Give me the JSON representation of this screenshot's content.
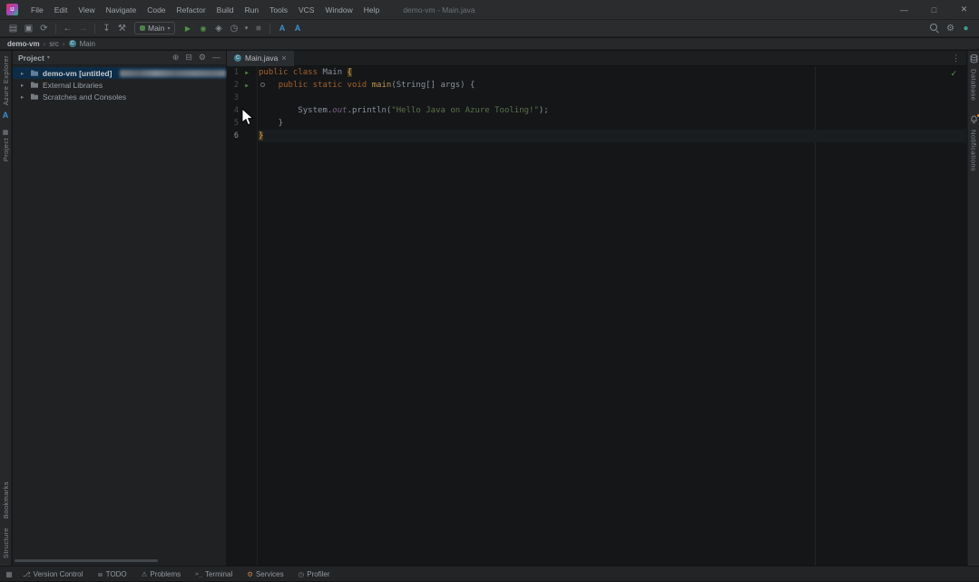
{
  "titlebar": {
    "logo_text": "IJ",
    "menus": [
      "File",
      "Edit",
      "View",
      "Navigate",
      "Code",
      "Refactor",
      "Build",
      "Run",
      "Tools",
      "VCS",
      "Window",
      "Help"
    ],
    "title": "demo-vm - Main.java",
    "controls": {
      "minimize": "—",
      "maximize": "□",
      "close": "✕"
    }
  },
  "toolbar": {
    "file_icons": [
      {
        "name": "open-icon",
        "glyph": "▤"
      },
      {
        "name": "save-all-icon",
        "glyph": "▣"
      },
      {
        "name": "sync-icon",
        "glyph": "⟳"
      }
    ],
    "nav_icons": [
      {
        "name": "back-icon",
        "glyph": "←"
      },
      {
        "name": "forward-icon",
        "glyph": "→"
      }
    ],
    "build_icons": [
      {
        "name": "update-project-icon",
        "glyph": "↧"
      },
      {
        "name": "build-hammer-icon",
        "glyph": "⚒"
      }
    ],
    "run_config": {
      "label": "Main",
      "chevron": "▾"
    },
    "run_icons": [
      {
        "name": "run-icon",
        "glyph": "▶"
      },
      {
        "name": "debug-icon",
        "glyph": "◉"
      },
      {
        "name": "coverage-icon",
        "glyph": "◈"
      },
      {
        "name": "profiler-icon",
        "glyph": "◷"
      },
      {
        "name": "run-more-chevron-icon",
        "glyph": "▾"
      },
      {
        "name": "stop-icon",
        "glyph": "■"
      }
    ],
    "azure_icons": [
      {
        "name": "azure-signin-icon",
        "glyph": "A"
      },
      {
        "name": "azure-explorer-icon",
        "glyph": "A"
      }
    ],
    "right_icons": {
      "settings": "⚙",
      "status_dot": "●"
    }
  },
  "breadcrumbs": {
    "separator": "›",
    "items": [
      {
        "label": "demo-vm"
      },
      {
        "label": "src"
      },
      {
        "label": "Main",
        "icon": "C"
      }
    ]
  },
  "left_stripe": {
    "azure_label": "Azure Explorer",
    "azure_icon": "A",
    "project_icon": "▦",
    "project_label": "Project",
    "bookmarks_label": "Bookmarks",
    "structure_label": "Structure"
  },
  "right_stripe": {
    "database_label": "Database",
    "notifications_label": "Notifications"
  },
  "project_panel": {
    "title": "Project",
    "title_chevron": "▾",
    "header_icons": [
      {
        "name": "locate-icon",
        "glyph": "⊕"
      },
      {
        "name": "collapse-all-icon",
        "glyph": "⊟"
      },
      {
        "name": "panel-settings-icon",
        "glyph": "⚙"
      },
      {
        "name": "hide-panel-icon",
        "glyph": "—"
      }
    ],
    "tree": [
      {
        "chevron": "▸",
        "label": "demo-vm [untitled]"
      },
      {
        "chevron": "▸",
        "label": "External Libraries"
      },
      {
        "chevron": "▸",
        "label": "Scratches and Consoles"
      }
    ]
  },
  "editor": {
    "tab": {
      "icon": "C",
      "label": "Main.java",
      "close": "×"
    },
    "more_icon": "⋮",
    "inspections_check": "✓",
    "run_glyph": "▶",
    "gutter_nums": [
      "1",
      "2",
      "3",
      "4",
      "5",
      "6"
    ],
    "code": {
      "l1_kw": "public class ",
      "l1_name": "Main ",
      "l1_brace": "{",
      "l2_indent": "    ",
      "l2_kw": "public static void ",
      "l2_method": "main",
      "l2_rest": "(String[] args) {",
      "l4_pre": "        System.",
      "l4_field": "out",
      "l4_call": ".println(",
      "l4_string": "\"Hello Java on Azure Tooling!\"",
      "l4_end": ");",
      "l5": "    }",
      "l6_brace": "}"
    }
  },
  "bottom_bar": {
    "switcher": "▦",
    "items": [
      {
        "icon": "⎇",
        "label": "Version Control"
      },
      {
        "icon": "≣",
        "label": "TODO"
      },
      {
        "icon": "⚠",
        "label": "Problems"
      },
      {
        "icon": ">_",
        "label": "Terminal"
      },
      {
        "icon": "⚙",
        "label": "Services"
      },
      {
        "icon": "◷",
        "label": "Profiler"
      }
    ]
  }
}
